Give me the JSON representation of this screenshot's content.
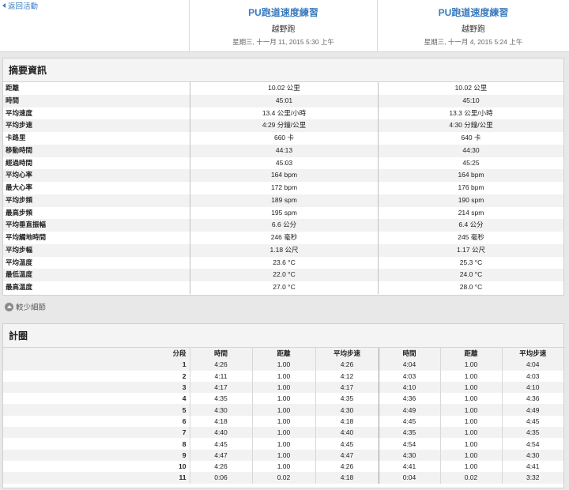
{
  "header": {
    "back_label": "返回活動",
    "activities": [
      {
        "title": "PU跑道速度練習",
        "type": "越野跑",
        "date": "星期三, 十一月 11, 2015 5:30 上午"
      },
      {
        "title": "PU跑道速度練習",
        "type": "越野跑",
        "date": "星期三, 十一月 4, 2015 5:24 上午"
      }
    ]
  },
  "summary": {
    "title": "摘要資訊",
    "rows": [
      {
        "label": "距離",
        "a": "10.02 公里",
        "b": "10.02 公里"
      },
      {
        "label": "時間",
        "a": "45:01",
        "b": "45:10"
      },
      {
        "label": "平均速度",
        "a": "13.4 公里/小時",
        "b": "13.3 公里/小時"
      },
      {
        "label": "平均步速",
        "a": "4:29 分鐘/公里",
        "b": "4:30 分鐘/公里"
      },
      {
        "label": "卡路里",
        "a": "660 卡",
        "b": "640 卡"
      },
      {
        "label": "移動時間",
        "a": "44:13",
        "b": "44:30"
      },
      {
        "label": "經過時間",
        "a": "45:03",
        "b": "45:25"
      },
      {
        "label": "平均心率",
        "a": "164 bpm",
        "b": "164 bpm"
      },
      {
        "label": "最大心率",
        "a": "172 bpm",
        "b": "176 bpm"
      },
      {
        "label": "平均步頻",
        "a": "189 spm",
        "b": "190 spm"
      },
      {
        "label": "最高步頻",
        "a": "195 spm",
        "b": "214 spm"
      },
      {
        "label": "平均垂直振幅",
        "a": "6.6 公分",
        "b": "6.4 公分"
      },
      {
        "label": "平均觸地時間",
        "a": "246 毫秒",
        "b": "245 毫秒"
      },
      {
        "label": "平均步幅",
        "a": "1.18 公尺",
        "b": "1.17 公尺"
      },
      {
        "label": "平均溫度",
        "a": "23.6 °C",
        "b": "25.3 °C"
      },
      {
        "label": "最低溫度",
        "a": "22.0 °C",
        "b": "24.0 °C"
      },
      {
        "label": "最高溫度",
        "a": "27.0 °C",
        "b": "28.0 °C"
      }
    ]
  },
  "less_details_label": "較少細節",
  "laps": {
    "title": "計圈",
    "headers": {
      "segment": "分段",
      "time": "時間",
      "distance": "距離",
      "avg_pace": "平均步速"
    },
    "rows": [
      {
        "seg": "1",
        "a": [
          "4:26",
          "1.00",
          "4:26"
        ],
        "b": [
          "4:04",
          "1.00",
          "4:04"
        ]
      },
      {
        "seg": "2",
        "a": [
          "4:11",
          "1.00",
          "4:12"
        ],
        "b": [
          "4:03",
          "1.00",
          "4:03"
        ]
      },
      {
        "seg": "3",
        "a": [
          "4:17",
          "1.00",
          "4:17"
        ],
        "b": [
          "4:10",
          "1.00",
          "4:10"
        ]
      },
      {
        "seg": "4",
        "a": [
          "4:35",
          "1.00",
          "4:35"
        ],
        "b": [
          "4:36",
          "1.00",
          "4:36"
        ]
      },
      {
        "seg": "5",
        "a": [
          "4:30",
          "1.00",
          "4:30"
        ],
        "b": [
          "4:49",
          "1.00",
          "4:49"
        ]
      },
      {
        "seg": "6",
        "a": [
          "4:18",
          "1.00",
          "4:18"
        ],
        "b": [
          "4:45",
          "1.00",
          "4:45"
        ]
      },
      {
        "seg": "7",
        "a": [
          "4:40",
          "1.00",
          "4:40"
        ],
        "b": [
          "4:35",
          "1.00",
          "4:35"
        ]
      },
      {
        "seg": "8",
        "a": [
          "4:45",
          "1.00",
          "4:45"
        ],
        "b": [
          "4:54",
          "1.00",
          "4:54"
        ]
      },
      {
        "seg": "9",
        "a": [
          "4:47",
          "1.00",
          "4:47"
        ],
        "b": [
          "4:30",
          "1.00",
          "4:30"
        ]
      },
      {
        "seg": "10",
        "a": [
          "4:26",
          "1.00",
          "4:26"
        ],
        "b": [
          "4:41",
          "1.00",
          "4:41"
        ]
      },
      {
        "seg": "11",
        "a": [
          "0:06",
          "0.02",
          "4:18"
        ],
        "b": [
          "0:04",
          "0.02",
          "3:32"
        ]
      }
    ]
  },
  "colors": {
    "link": "#3a7bbf",
    "panel_header_bg": "#f4f4f4",
    "stripe": "#f2f2f2"
  },
  "icons": {
    "back": "left-triangle-icon",
    "less": "collapse-circle-icon"
  }
}
